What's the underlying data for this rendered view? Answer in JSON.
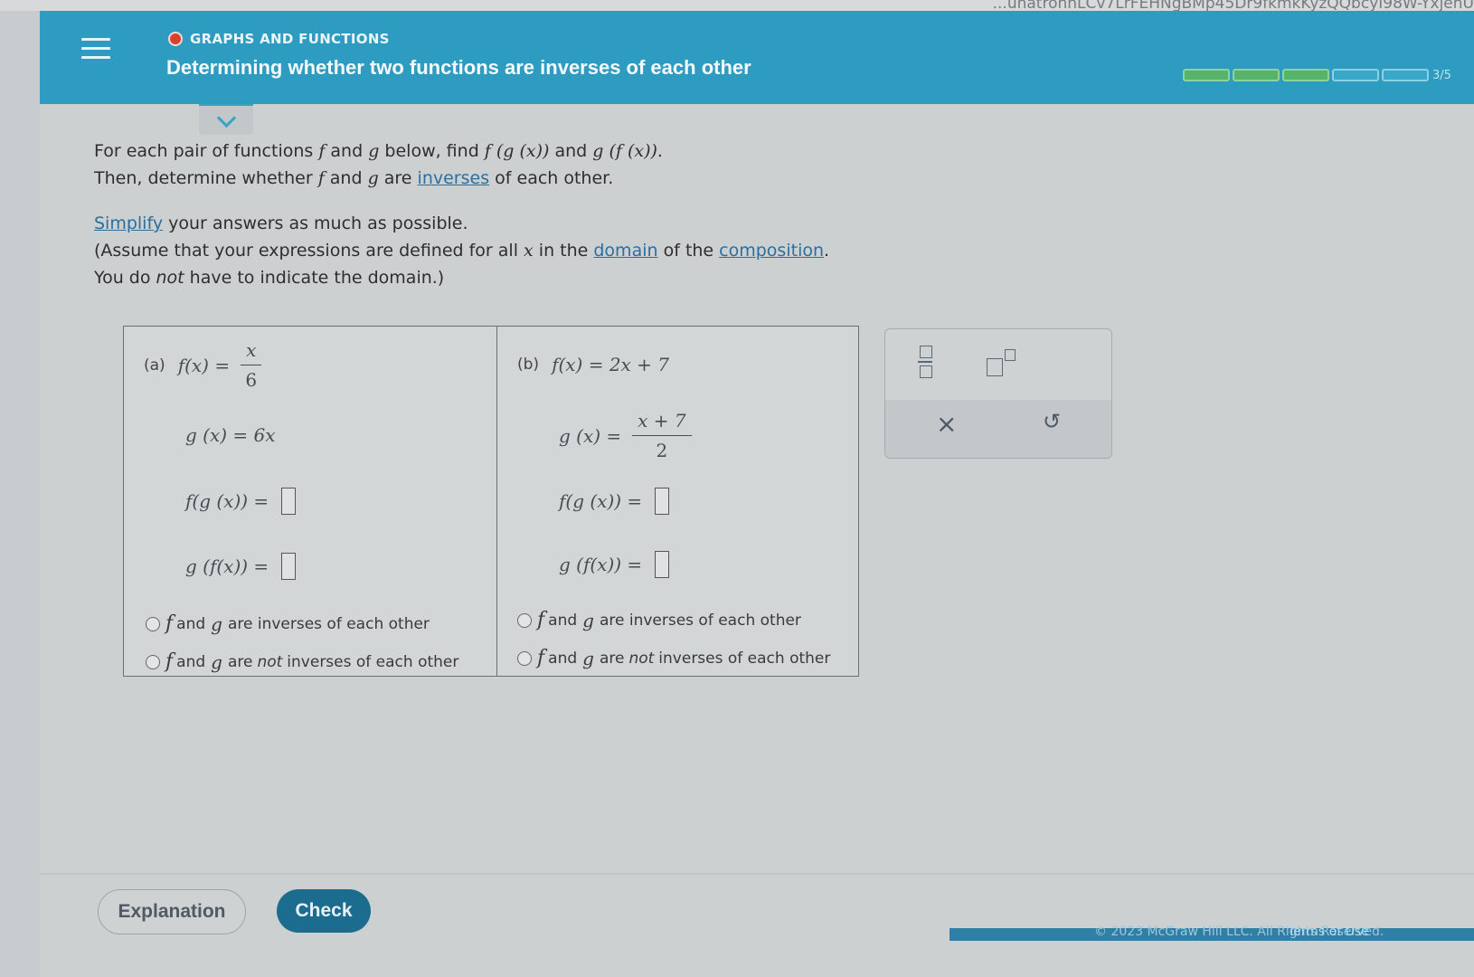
{
  "browser": {
    "url_fragment": "...unatronnLCv7LrFEHNgBMp45Dr9fkmkKyzQQbcyI98W-YxjehU"
  },
  "header": {
    "topic": "GRAPHS AND FUNCTIONS",
    "title": "Determining whether two functions are inverses of each other",
    "progress": {
      "completed": 3,
      "total": 5,
      "label": "3/5"
    }
  },
  "instructions": {
    "line1_a": "For each pair of functions ",
    "f": "f",
    "line1_b": " and ",
    "g": "g",
    "line1_c": " below, find ",
    "fgx": "f (g (x))",
    "line1_d": " and ",
    "gfx": "g (f (x)).",
    "line2_a": "Then, determine whether ",
    "line2_b": " and ",
    "line2_c": " are ",
    "inverses_link": "inverses",
    "line2_d": " of each other.",
    "simplify_link": "Simplify",
    "line3": " your answers as much as possible.",
    "line4_a": "(Assume that your expressions are defined for all ",
    "x": "x",
    "line4_b": " in the ",
    "domain_link": "domain",
    "line4_c": " of the ",
    "composition_link": "composition",
    "line4_d": ".",
    "line5_a": "You do ",
    "line5_not": "not",
    "line5_b": " have to indicate the domain.)"
  },
  "part_a": {
    "label": "(a)",
    "f_def": "f(x) =",
    "f_num": "x",
    "f_den": "6",
    "g_def": "g (x) = 6x",
    "fg_prompt": "f(g (x)) =",
    "gf_prompt": "g (f(x)) =",
    "option1": {
      "f": "f",
      "mid": "and",
      "g": "g",
      "rest": "are inverses of each other"
    },
    "option2": {
      "f": "f",
      "mid": "and",
      "g": "g",
      "are": "are",
      "not": "not",
      "rest": "inverses of each other"
    }
  },
  "part_b": {
    "label": "(b)",
    "f_def": "f(x) = 2x + 7",
    "g_def": "g (x) =",
    "g_num": "x + 7",
    "g_den": "2",
    "fg_prompt": "f(g (x)) =",
    "gf_prompt": "g (f(x)) =",
    "option1": {
      "f": "f",
      "mid": "and",
      "g": "g",
      "rest": "are inverses of each other"
    },
    "option2": {
      "f": "f",
      "mid": "and",
      "g": "g",
      "are": "are",
      "not": "not",
      "rest": "inverses of each other"
    }
  },
  "palette": {
    "times": "×",
    "undo": "↺"
  },
  "buttons": {
    "explanation": "Explanation",
    "check": "Check"
  },
  "footer": {
    "copyright": "© 2023 McGraw Hill LLC. All Rights Reserved.",
    "terms": "Terms of Use"
  },
  "colors": {
    "header": "#2e9cc0",
    "check_button": "#1c6c8f",
    "progress_done": "#58b36a",
    "topic_dot": "#d9412f"
  }
}
